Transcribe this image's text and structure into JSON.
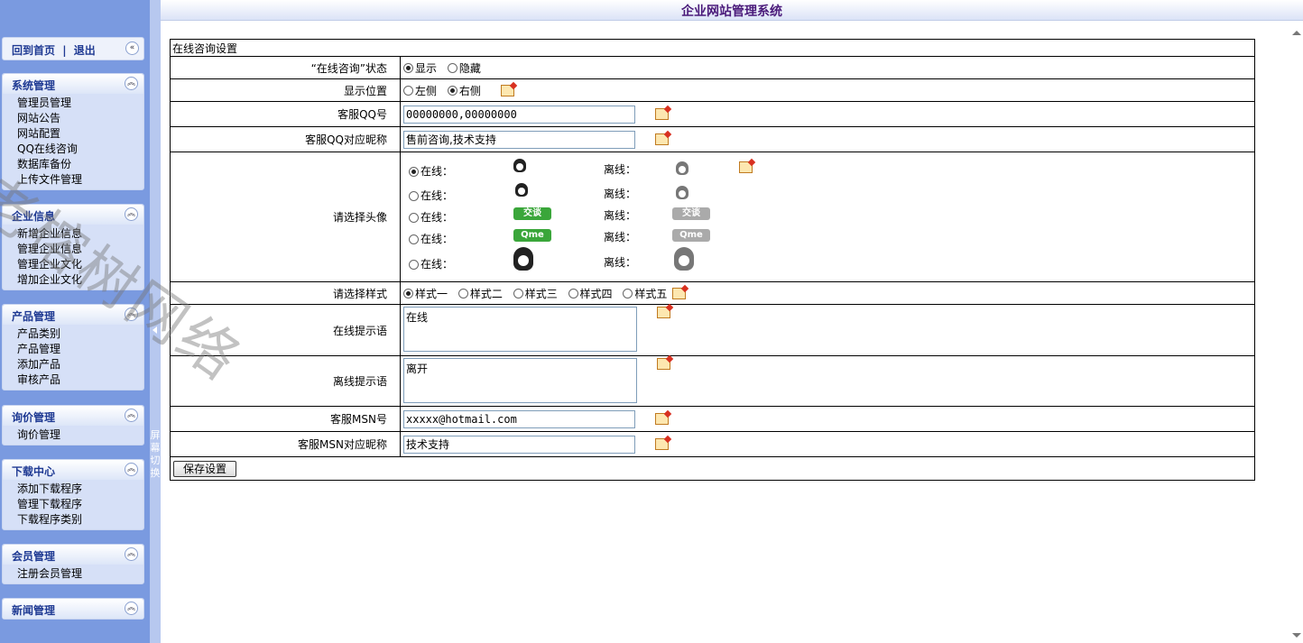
{
  "app_title": "企业网站管理系统",
  "top_links": {
    "home": "回到首页",
    "sep": "|",
    "logout": "退出"
  },
  "splitter_text": "屏幕切换",
  "menus": [
    {
      "title": "系统管理",
      "items": [
        "管理员管理",
        "网站公告",
        "网站配置",
        "QQ在线咨询",
        "数据库备份",
        "上传文件管理"
      ]
    },
    {
      "title": "企业信息",
      "items": [
        "新增企业信息",
        "管理企业信息",
        "管理企业文化",
        "增加企业文化"
      ]
    },
    {
      "title": "产品管理",
      "items": [
        "产品类别",
        "产品管理",
        "添加产品",
        "审核产品"
      ]
    },
    {
      "title": "询价管理",
      "items": [
        "询价管理"
      ]
    },
    {
      "title": "下载中心",
      "items": [
        "添加下载程序",
        "管理下载程序",
        "下载程序类别"
      ]
    },
    {
      "title": "会员管理",
      "items": [
        "注册会员管理"
      ]
    },
    {
      "title": "新闻管理",
      "items": []
    }
  ],
  "form": {
    "section_title": "在线咨询设置",
    "status": {
      "label": "“在线咨询”状态",
      "options": [
        "显示",
        "隐藏"
      ],
      "selected": "显示"
    },
    "position": {
      "label": "显示位置",
      "options": [
        "左侧",
        "右侧"
      ],
      "selected": "右侧"
    },
    "qq": {
      "label": "客服QQ号",
      "value": "00000000,00000000"
    },
    "qq_nick": {
      "label": "客服QQ对应昵称",
      "value": "售前咨询,技术支持"
    },
    "avatar": {
      "label": "请选择头像",
      "online_label": "在线：",
      "offline_label": "离线：",
      "selected_index": 0,
      "rows": [
        {
          "online_icon": "qq-penguin-small-icon",
          "offline_icon": "qq-penguin-small-gray-icon"
        },
        {
          "online_icon": "qq-penguin-chat-icon",
          "offline_icon": "qq-penguin-small-gray-icon"
        },
        {
          "online_icon": "qq-jiaotan-badge-icon",
          "offline_icon": "qq-jiaotan-badge-gray-icon",
          "badge_text": "交谈"
        },
        {
          "online_icon": "qq-qme-badge-icon",
          "offline_icon": "qq-qme-badge-gray-icon",
          "badge_text": "Qme"
        },
        {
          "online_icon": "qq-penguin-large-icon",
          "offline_icon": "qq-penguin-large-gray-icon"
        }
      ]
    },
    "style": {
      "label": "请选择样式",
      "options": [
        "样式一",
        "样式二",
        "样式三",
        "样式四",
        "样式五"
      ],
      "selected": "样式一"
    },
    "online_tip": {
      "label": "在线提示语",
      "value": "在线"
    },
    "offline_tip": {
      "label": "离线提示语",
      "value": "离开"
    },
    "msn": {
      "label": "客服MSN号",
      "value": "xxxxx@hotmail.com"
    },
    "msn_nick": {
      "label": "客服MSN对应昵称",
      "value": "技术支持"
    },
    "save_label": "保存设置"
  },
  "watermark": "老榕树网络",
  "colors": {
    "sidebar": "#7a9ae0",
    "menu_title": "#1f3a93",
    "app_title": "#4a1a7a"
  }
}
